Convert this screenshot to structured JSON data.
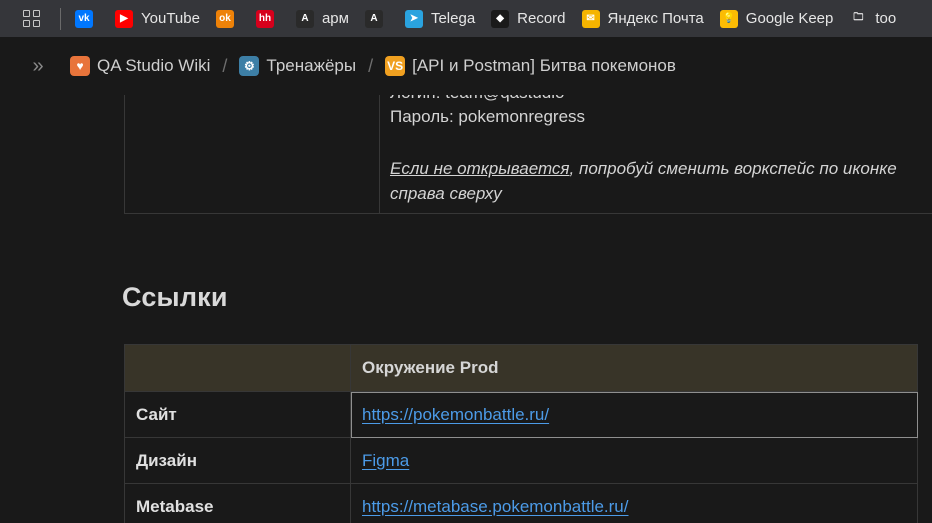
{
  "bookmarks": [
    {
      "label": "",
      "icon": "vk-icon",
      "color": "#0077ff",
      "glyph": "vk"
    },
    {
      "label": "YouTube",
      "icon": "youtube-icon",
      "color": "#ff0000",
      "glyph": "▶"
    },
    {
      "label": "",
      "icon": "odnoklassniki-icon",
      "color": "#ee8208",
      "glyph": "ok"
    },
    {
      "label": "",
      "icon": "hh-icon",
      "color": "#d6001c",
      "glyph": "hh"
    },
    {
      "label": "арм",
      "icon": "arm-icon",
      "color": "#2a2a2a",
      "glyph": "A"
    },
    {
      "label": "",
      "icon": "app-icon",
      "color": "#2a2a2a",
      "glyph": "A"
    },
    {
      "label": "Telega",
      "icon": "telegram-icon",
      "color": "#2aa3df",
      "glyph": "➤"
    },
    {
      "label": "Record",
      "icon": "record-icon",
      "color": "#1a1a1a",
      "glyph": "◆"
    },
    {
      "label": "Яндекс Почта",
      "icon": "mail-icon",
      "color": "#f5b400",
      "glyph": "✉"
    },
    {
      "label": "Google Keep",
      "icon": "keep-icon",
      "color": "#fbbc04",
      "glyph": "💡"
    },
    {
      "label": "too",
      "icon": "folder-icon",
      "color": "transparent",
      "glyph": "🗀"
    }
  ],
  "breadcrumb": {
    "items": [
      {
        "label": "QA Studio Wiki",
        "icon": "qa-studio-icon",
        "color": "#e8743b",
        "glyph": "♥"
      },
      {
        "label": "Тренажёры",
        "icon": "gear-icon",
        "color": "#3d7fa6",
        "glyph": "⚙"
      },
      {
        "label": "[API и Postman] Битва покемонов",
        "icon": "postman-battle-icon",
        "color": "#f0a020",
        "glyph": "VS"
      }
    ]
  },
  "top_table": {
    "partial_line": "Логин: team@qastudio",
    "password": "Пароль: pokemonregress",
    "note_link": "Если не открывается",
    "note_rest": ", попробуй сменить воркспейс по иконке справа сверху"
  },
  "links": {
    "heading": "Ссылки",
    "header": {
      "empty": "",
      "env": "Окружение Prod"
    },
    "rows": [
      {
        "name": "Сайт",
        "value": "https://pokemonbattle.ru/"
      },
      {
        "name": "Дизайн",
        "value": "Figma"
      },
      {
        "name": "Metabase",
        "value": "https://metabase.pokemonbattle.ru/"
      }
    ]
  }
}
